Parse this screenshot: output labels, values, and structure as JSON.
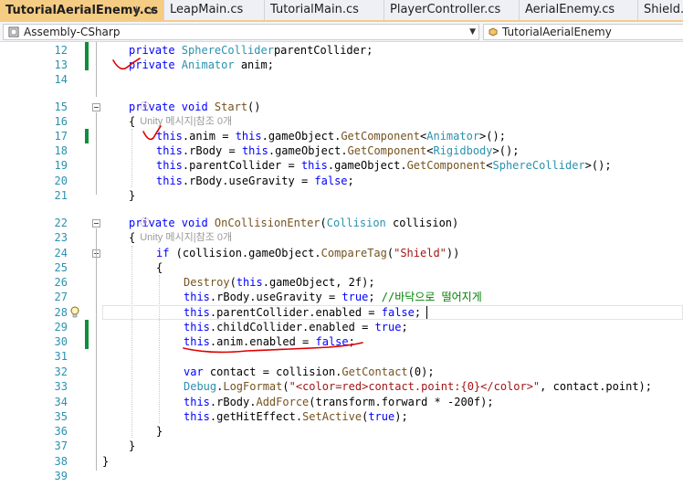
{
  "tabs": [
    {
      "label": "TutorialAerialEnemy.cs",
      "active": true
    },
    {
      "label": "LeapMain.cs"
    },
    {
      "label": "TutorialMain.cs"
    },
    {
      "label": "PlayerController.cs"
    },
    {
      "label": "AerialEnemy.cs"
    },
    {
      "label": "Shield.cs"
    }
  ],
  "tab_icons": {
    "pin": "pin-icon",
    "close": "close-icon"
  },
  "nav": {
    "project": "Assembly-CSharp",
    "type": "TutorialAerialEnemy"
  },
  "hints": {
    "start": "Unity 메시지|참조 0개",
    "on_collision": "Unity 메시지|참조 0개"
  },
  "lines": [
    {
      "n": "12",
      "tokens": [
        [
          "kw",
          "private "
        ],
        [
          "ty",
          "SphereCollider"
        ],
        [
          "",
          "parentCollider;"
        ]
      ]
    },
    {
      "n": "13",
      "tokens": [
        [
          "kw",
          "private "
        ],
        [
          "ty",
          "Animator"
        ],
        [
          "",
          " anim;"
        ]
      ]
    },
    {
      "n": "14",
      "tokens": []
    },
    {
      "n": "15",
      "tokens": [
        [
          "kw",
          "private void "
        ],
        [
          "mt",
          "Start"
        ],
        [
          "",
          "()"
        ]
      ]
    },
    {
      "n": "16",
      "tokens": [
        [
          "",
          "{"
        ]
      ]
    },
    {
      "n": "17",
      "tokens": [
        [
          "kw",
          "this"
        ],
        [
          "",
          ".anim = "
        ],
        [
          "kw",
          "this"
        ],
        [
          "",
          ".gameObject."
        ],
        [
          "mt",
          "GetComponent"
        ],
        [
          "",
          "<"
        ],
        [
          "ty",
          "Animator"
        ],
        [
          "",
          ">();"
        ]
      ]
    },
    {
      "n": "18",
      "tokens": [
        [
          "kw",
          "this"
        ],
        [
          "",
          ".rBody = "
        ],
        [
          "kw",
          "this"
        ],
        [
          "",
          ".gameObject."
        ],
        [
          "mt",
          "GetComponent"
        ],
        [
          "",
          "<"
        ],
        [
          "ty",
          "Rigidbody"
        ],
        [
          "",
          ">();"
        ]
      ]
    },
    {
      "n": "19",
      "tokens": [
        [
          "kw",
          "this"
        ],
        [
          "",
          ".parentCollider = "
        ],
        [
          "kw",
          "this"
        ],
        [
          "",
          ".gameObject."
        ],
        [
          "mt",
          "GetComponent"
        ],
        [
          "",
          "<"
        ],
        [
          "ty",
          "SphereCollider"
        ],
        [
          "",
          ">();"
        ]
      ]
    },
    {
      "n": "20",
      "tokens": [
        [
          "kw",
          "this"
        ],
        [
          "",
          ".rBody.useGravity = "
        ],
        [
          "kw",
          "false"
        ],
        [
          "",
          ";"
        ]
      ]
    },
    {
      "n": "21",
      "tokens": [
        [
          "",
          "}"
        ]
      ]
    },
    {
      "n": "22",
      "tokens": [
        [
          "kw",
          "private void "
        ],
        [
          "mt",
          "OnCollisionEnter"
        ],
        [
          "",
          "("
        ],
        [
          "ty",
          "Collision"
        ],
        [
          "",
          " collision)"
        ]
      ]
    },
    {
      "n": "23",
      "tokens": [
        [
          "",
          "{"
        ]
      ]
    },
    {
      "n": "24",
      "tokens": [
        [
          "kw",
          "if"
        ],
        [
          "",
          " (collision.gameObject."
        ],
        [
          "mt",
          "CompareTag"
        ],
        [
          "",
          "("
        ],
        [
          "st",
          "\"Shield\""
        ],
        [
          "",
          "))"
        ]
      ]
    },
    {
      "n": "25",
      "tokens": [
        [
          "",
          "{"
        ]
      ]
    },
    {
      "n": "26",
      "tokens": [
        [
          "mt",
          "Destroy"
        ],
        [
          "",
          "("
        ],
        [
          "kw",
          "this"
        ],
        [
          "",
          ".gameObject, 2f);"
        ]
      ]
    },
    {
      "n": "27",
      "tokens": [
        [
          "kw",
          "this"
        ],
        [
          "",
          ".rBody.useGravity = "
        ],
        [
          "kw",
          "true"
        ],
        [
          "",
          "; "
        ],
        [
          "cm",
          "//바닥으로 떨어지게"
        ]
      ]
    },
    {
      "n": "28",
      "tokens": [
        [
          "kw",
          "this"
        ],
        [
          "",
          ".parentCollider.enabled = "
        ],
        [
          "kw",
          "false"
        ],
        [
          "",
          ";"
        ]
      ]
    },
    {
      "n": "29",
      "tokens": [
        [
          "kw",
          "this"
        ],
        [
          "",
          ".childCollider.enabled = "
        ],
        [
          "kw",
          "true"
        ],
        [
          "",
          ";"
        ]
      ]
    },
    {
      "n": "30",
      "tokens": [
        [
          "kw",
          "this"
        ],
        [
          "",
          ".anim.enabled = "
        ],
        [
          "kw",
          "false"
        ],
        [
          "",
          ";"
        ]
      ]
    },
    {
      "n": "31",
      "tokens": []
    },
    {
      "n": "32",
      "tokens": [
        [
          "kw",
          "var"
        ],
        [
          "",
          " contact = collision."
        ],
        [
          "mt",
          "GetContact"
        ],
        [
          "",
          "(0);"
        ]
      ]
    },
    {
      "n": "33",
      "tokens": [
        [
          "ty",
          "Debug"
        ],
        [
          "",
          "."
        ],
        [
          "mt",
          "LogFormat"
        ],
        [
          "",
          "("
        ],
        [
          "st",
          "\"<color=red>contact.point:{0}</color>\""
        ],
        [
          "",
          ", contact.point);"
        ]
      ]
    },
    {
      "n": "34",
      "tokens": [
        [
          "kw",
          "this"
        ],
        [
          "",
          ".rBody."
        ],
        [
          "mt",
          "AddForce"
        ],
        [
          "",
          "(transform.forward * -200f);"
        ]
      ]
    },
    {
      "n": "35",
      "tokens": [
        [
          "kw",
          "this"
        ],
        [
          "",
          ".getHitEffect."
        ],
        [
          "mt",
          "SetActive"
        ],
        [
          "",
          "("
        ],
        [
          "kw",
          "true"
        ],
        [
          "",
          ");"
        ]
      ]
    },
    {
      "n": "36",
      "tokens": [
        [
          "",
          "}"
        ]
      ]
    },
    {
      "n": "37",
      "tokens": [
        [
          "",
          "}"
        ]
      ]
    },
    {
      "n": "38",
      "tokens": [
        [
          "",
          "}"
        ]
      ]
    },
    {
      "n": "39",
      "tokens": []
    }
  ]
}
